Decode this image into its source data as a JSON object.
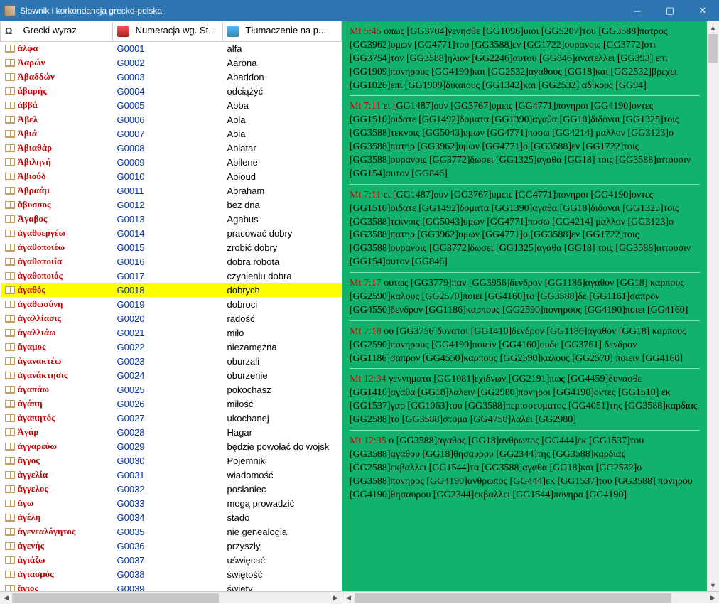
{
  "window": {
    "title": "Słownik i korkondancja grecko-polska"
  },
  "columns": {
    "greek": "Grecki wyraz",
    "number": "Numeracja wg. St...",
    "trans": "Tłumaczenie na p..."
  },
  "selected_code": "G0018",
  "rows": [
    {
      "g": "ἄλφα",
      "c": "G0001",
      "p": "alfa"
    },
    {
      "g": "Ἀαρών",
      "c": "G0002",
      "p": "Aarona"
    },
    {
      "g": "Ἀβαδδών",
      "c": "G0003",
      "p": "Abaddon"
    },
    {
      "g": "ἀβαρής",
      "c": "G0004",
      "p": "odciążyć"
    },
    {
      "g": "ἀββά",
      "c": "G0005",
      "p": "Abba"
    },
    {
      "g": "Ἄβελ",
      "c": "G0006",
      "p": "Abla"
    },
    {
      "g": "Ἀβιά",
      "c": "G0007",
      "p": "Abia"
    },
    {
      "g": "Ἀβιαθάρ",
      "c": "G0008",
      "p": "Abiatar"
    },
    {
      "g": "Ἀβιληνή",
      "c": "G0009",
      "p": "Abilene"
    },
    {
      "g": "Ἀβιούδ",
      "c": "G0010",
      "p": "Abioud"
    },
    {
      "g": "Ἀβραάμ",
      "c": "G0011",
      "p": "Abraham"
    },
    {
      "g": "ἄβυσσος",
      "c": "G0012",
      "p": "bez dna"
    },
    {
      "g": "Ἄγαβος",
      "c": "G0013",
      "p": "Agabus"
    },
    {
      "g": "ἀγαθοεργέω",
      "c": "G0014",
      "p": "pracować dobry"
    },
    {
      "g": "ἀγαθοποιέω",
      "c": "G0015",
      "p": "zrobić dobry"
    },
    {
      "g": "ἀγαθοποιΐα",
      "c": "G0016",
      "p": "dobra robota"
    },
    {
      "g": "ἀγαθοποιός",
      "c": "G0017",
      "p": "czynieniu dobra"
    },
    {
      "g": "ἀγαθός",
      "c": "G0018",
      "p": "dobrych"
    },
    {
      "g": "ἀγαθωσύνη",
      "c": "G0019",
      "p": "dobroci"
    },
    {
      "g": "ἀγαλλίασις",
      "c": "G0020",
      "p": "radość"
    },
    {
      "g": "ἀγαλλιάω",
      "c": "G0021",
      "p": "miło"
    },
    {
      "g": "ἄγαμος",
      "c": "G0022",
      "p": "niezamężna"
    },
    {
      "g": "ἀγανακτέω",
      "c": "G0023",
      "p": "oburzali"
    },
    {
      "g": "ἀγανάκτησις",
      "c": "G0024",
      "p": "oburzenie"
    },
    {
      "g": "ἀγαπάω",
      "c": "G0025",
      "p": "pokochasz"
    },
    {
      "g": "ἀγάπη",
      "c": "G0026",
      "p": "miłość"
    },
    {
      "g": "ἀγαπητός",
      "c": "G0027",
      "p": "ukochanej"
    },
    {
      "g": "Ἁγάρ",
      "c": "G0028",
      "p": "Hagar"
    },
    {
      "g": "ἀγγαρεύω",
      "c": "G0029",
      "p": "będzie powołać do wojsk"
    },
    {
      "g": "ἄγγος",
      "c": "G0030",
      "p": "Pojemniki"
    },
    {
      "g": "ἀγγελία",
      "c": "G0031",
      "p": "wiadomość"
    },
    {
      "g": "ἄγγελος",
      "c": "G0032",
      "p": "posłaniec"
    },
    {
      "g": "ἄγω",
      "c": "G0033",
      "p": "mogą prowadzić"
    },
    {
      "g": "ἀγέλη",
      "c": "G0034",
      "p": "stado"
    },
    {
      "g": "ἀγενεαλόγητος",
      "c": "G0035",
      "p": "nie genealogia"
    },
    {
      "g": "ἀγενής",
      "c": "G0036",
      "p": "przyszły"
    },
    {
      "g": "ἁγιάζω",
      "c": "G0037",
      "p": "uświęcać"
    },
    {
      "g": "ἁγιασμός",
      "c": "G0038",
      "p": "świętość"
    },
    {
      "g": "ἅγιος",
      "c": "G0039",
      "p": "święty"
    }
  ],
  "verses": [
    {
      "ref": "Mt 5:45",
      "text": "οπως [GG3704]γενησθε [GG1096]υιοι [GG5207]του [GG3588]πατρος [GG3962]υμων [GG4771]του [GG3588]εν [GG1722]ουρανοις [GG3772]οτι [GG3754]τον [GG3588]ηλιον [GG2246]αυτου [GG846]ανατελλει [GG393] επι [GG1909]πονηρους [GG4190]και [GG2532]αγαθους [GG18]και [GG2532]βρεχει [GG1026]επι [GG1909]δικαιους [GG1342]και [GG2532] αδικους [GG94]"
    },
    {
      "ref": "Mt 7:11",
      "text": "ει [GG1487]ουν [GG3767]υμεις [GG4771]πονηροι [GG4190]οντες [GG1510]οιδατε [GG1492]δοματα [GG1390]αγαθα [GG18]διδοναι [GG1325]τοις [GG3588]τεκνοις [GG5043]υμων [GG4771]ποσω [GG4214] μαλλον [GG3123]ο [GG3588]πατηρ [GG3962]υμων [GG4771]ο [GG3588]εν [GG1722]τοις [GG3588]ουρανοις [GG3772]δωσει [GG1325]αγαθα [GG18] τοις [GG3588]αιτουσιν [GG154]αυτον [GG846]"
    },
    {
      "ref": "Mt 7:11",
      "text": "ει [GG1487]ουν [GG3767]υμεις [GG4771]πονηροι [GG4190]οντες [GG1510]οιδατε [GG1492]δοματα [GG1390]αγαθα [GG18]διδοναι [GG1325]τοις [GG3588]τεκνοις [GG5043]υμων [GG4771]ποσω [GG4214] μαλλον [GG3123]ο [GG3588]πατηρ [GG3962]υμων [GG4771]ο [GG3588]εν [GG1722]τοις [GG3588]ουρανοις [GG3772]δωσει [GG1325]αγαθα [GG18] τοις [GG3588]αιτουσιν [GG154]αυτον [GG846]"
    },
    {
      "ref": "Mt 7:17",
      "text": "ουτως [GG3779]παν [GG3956]δενδρον [GG1186]αγαθον [GG18] καρπους [GG2590]καλους [GG2570]ποιει [GG4160]το [GG3588]δε [GG1161]σαπρον [GG4550]δενδρον [GG1186]καρπους [GG2590]πονηρους [GG4190]ποιει [GG4160]"
    },
    {
      "ref": "Mt 7:18",
      "text": "ου [GG3756]δυναται [GG1410]δενδρον [GG1186]αγαθον [GG18] καρπους [GG2590]πονηρους [GG4190]ποιειν [GG4160]ουδε [GG3761] δενδρον [GG1186]σαπρον [GG4550]καρπους [GG2590]καλους [GG2570] ποιειν [GG4160]"
    },
    {
      "ref": "Mt 12:34",
      "text": "γεννηματα [GG1081]εχιδνων [GG2191]πως [GG4459]δυνασθε [GG1410]αγαθα [GG18]λαλειν [GG2980]πονηροι [GG4190]οντες [GG1510] εκ [GG1537]γαρ [GG1063]του [GG3588]περισσευματος [GG4051]της [GG3588]καρδιας [GG2588]το [GG3588]στομα [GG4750]λαλει [GG2980]"
    },
    {
      "ref": "Mt 12:35",
      "text": "ο [GG3588]αγαθος [GG18]ανθρωπος [GG444]εκ [GG1537]του [GG3588]αγαθου [GG18]θησαυρου [GG2344]της [GG3588]καρδιας [GG2588]εκβαλλει [GG1544]τα [GG3588]αγαθα [GG18]και [GG2532]ο [GG3588]πονηρος [GG4190]ανθρωπος [GG444]εκ [GG1537]του [GG3588] πονηρου [GG4190]θησαυρου [GG2344]εκβαλλει [GG1544]πονηρα [GG4190]"
    }
  ]
}
